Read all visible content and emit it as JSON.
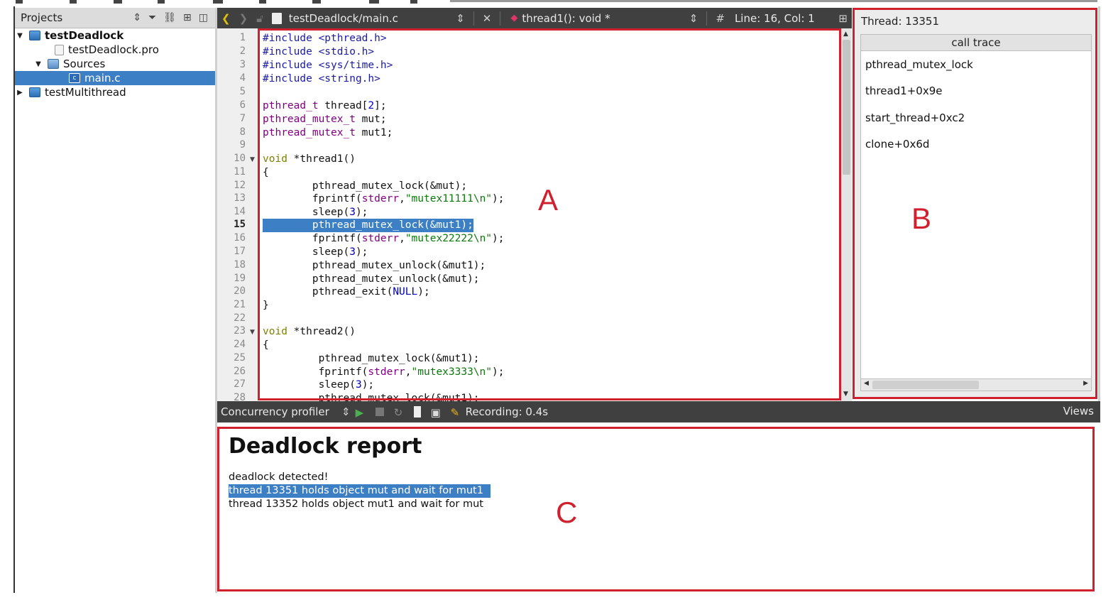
{
  "projects": {
    "header": "Projects",
    "items": [
      {
        "label": "testDeadlock",
        "bold": true
      },
      {
        "label": "testDeadlock.pro"
      },
      {
        "label": "Sources"
      },
      {
        "label": "main.c"
      },
      {
        "label": "testMultithread"
      }
    ]
  },
  "editor": {
    "file": "testDeadlock/main.c",
    "function": "thread1(): void *",
    "position": "Line: 16, Col: 1",
    "line_numbers": [
      "1",
      "2",
      "3",
      "4",
      "5",
      "6",
      "7",
      "8",
      "9",
      "10",
      "11",
      "12",
      "13",
      "14",
      "15",
      "16",
      "17",
      "18",
      "19",
      "20",
      "21",
      "22",
      "23",
      "24",
      "25",
      "26",
      "27",
      "28"
    ]
  },
  "threads": {
    "label": "Thread:",
    "id": "13351",
    "calltrace_header": "call trace",
    "frames": [
      "pthread_mutex_lock",
      "thread1+0x9e",
      "start_thread+0xc2",
      "clone+0x6d"
    ]
  },
  "profiler": {
    "name": "Concurrency profiler",
    "status": "Recording: 0.4s",
    "views": "Views"
  },
  "report": {
    "title": "Deadlock report",
    "lines": [
      "deadlock detected!",
      "thread 13351 holds object mut and wait for mut1",
      "thread 13352 holds object mut1 and wait for mut"
    ]
  },
  "annotations": {
    "a": "A",
    "b": "B",
    "c": "C"
  },
  "colors": {
    "selection": "#3d7fc4",
    "annotation": "#d0202e",
    "toolbar": "#404040"
  }
}
